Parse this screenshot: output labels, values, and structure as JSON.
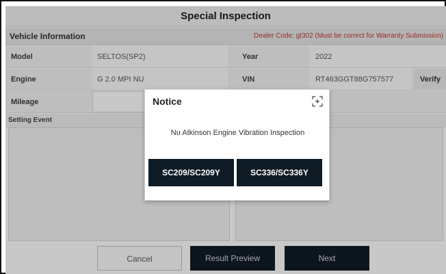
{
  "title": "Special Inspection",
  "vehicle_info": {
    "section_title": "Vehicle Information",
    "dealer_notice": "Dealer Code: gt302  (Must be correct for Warranty Submission)",
    "model_label": "Model",
    "model_value": "SELTOS(SP2)",
    "year_label": "Year",
    "year_value": "2022",
    "engine_label": "Engine",
    "engine_value": "G 2.0 MPI NU",
    "vin_label": "VIN",
    "vin_value": "RT463GGT88G757577",
    "verify_label": "Verify",
    "mileage_label": "Mileage",
    "mileage_value": ""
  },
  "setting_event": {
    "title": "Setting Event"
  },
  "buttons": {
    "cancel": "Cancel",
    "result_preview": "Result Preview",
    "next": "Next"
  },
  "notice_dialog": {
    "title": "Notice",
    "expand_icon": "expand-icon",
    "message": "Nu Atkinson Engine Vibration Inspection",
    "option_1": "SC209/SC209Y",
    "option_2": "SC336/SC336Y"
  },
  "colors": {
    "dark_button": "#0f1c26",
    "dealer_red": "#c0392b"
  }
}
